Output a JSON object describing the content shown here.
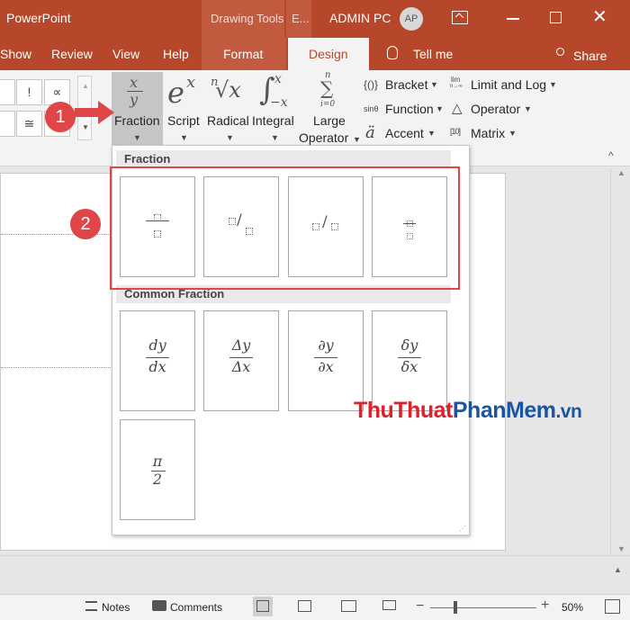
{
  "titlebar": {
    "app_title": "PowerPoint",
    "context_group": "Drawing Tools",
    "context_group_2": "E...",
    "user_name": "ADMIN PC",
    "avatar_initials": "AP"
  },
  "tabs": {
    "show": "Show",
    "review": "Review",
    "view": "View",
    "help": "Help",
    "format": "Format",
    "design": "Design",
    "tell_me": "Tell me",
    "share": "Share"
  },
  "ribbon": {
    "symbols": [
      "!",
      "∝",
      "≅",
      "≈"
    ],
    "fraction": {
      "label": "Fraction",
      "glyph_num": "x",
      "glyph_den": "y"
    },
    "script": {
      "label": "Script",
      "glyph": "e",
      "sup": "x"
    },
    "radical": {
      "label": "Radical",
      "index": "n",
      "glyph": "√x"
    },
    "integral": {
      "label": "Integral",
      "glyph": "∫",
      "upper": "x",
      "lower": "−x"
    },
    "large_operator": {
      "label_1": "Large",
      "label_2": "Operator",
      "top": "n",
      "glyph": "∑",
      "bottom": "i=0"
    },
    "bracket": {
      "label": "Bracket",
      "icon": "{()}"
    },
    "function": {
      "label": "Function",
      "icon": "sinθ"
    },
    "accent": {
      "label": "Accent",
      "icon": "ä"
    },
    "limit_log": {
      "label": "Limit and Log",
      "icon_top": "lim",
      "icon_bottom": "n→∞"
    },
    "operator": {
      "label": "Operator",
      "icon": "△"
    },
    "matrix": {
      "label": "Matrix",
      "icon": "[10]"
    }
  },
  "dropdown": {
    "section_fraction": "Fraction",
    "section_common": "Common Fraction",
    "common_fractions": [
      {
        "num": "dy",
        "den": "dx"
      },
      {
        "num": "Δy",
        "den": "Δx"
      },
      {
        "num": "∂y",
        "den": "∂x"
      },
      {
        "num": "δy",
        "den": "δx"
      },
      {
        "num": "π",
        "den": "2"
      }
    ],
    "skewed_slash": "/"
  },
  "annotations": {
    "step_1": "1",
    "step_2": "2"
  },
  "watermark": {
    "part_1": "Thu",
    "part_2": "Thuat",
    "part_3": "PhanMem",
    "part_4": ".vn"
  },
  "status": {
    "notes": "Notes",
    "comments": "Comments",
    "zoom_minus": "−",
    "zoom_plus": "+",
    "zoom": "50%"
  },
  "colors": {
    "accent": "#b7472a",
    "annotation": "#e04547",
    "watermark_red": "#e0202a",
    "watermark_blue": "#1a55a5"
  }
}
